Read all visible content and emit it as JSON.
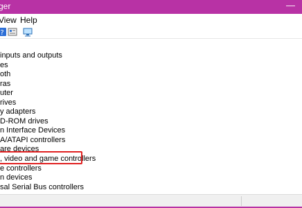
{
  "window": {
    "title": "ger"
  },
  "menu": {
    "view": "View",
    "help": "Help"
  },
  "tree_items": [
    "inputs and outputs",
    "es",
    "oth",
    "ras",
    "uter",
    "rives",
    "y adapters",
    "D-ROM drives",
    "n Interface Devices",
    "A/ATAPI controllers",
    "are devices",
    ", video and game controllers",
    "e controllers",
    "n devices",
    "sal Serial Bus controllers"
  ],
  "highlighted_item_index": 11,
  "colors": {
    "titlebar": "#b832a5",
    "highlight_border": "#e02020"
  },
  "icons": [
    "help-icon",
    "properties-icon",
    "monitor-icon",
    "minimize-icon"
  ]
}
